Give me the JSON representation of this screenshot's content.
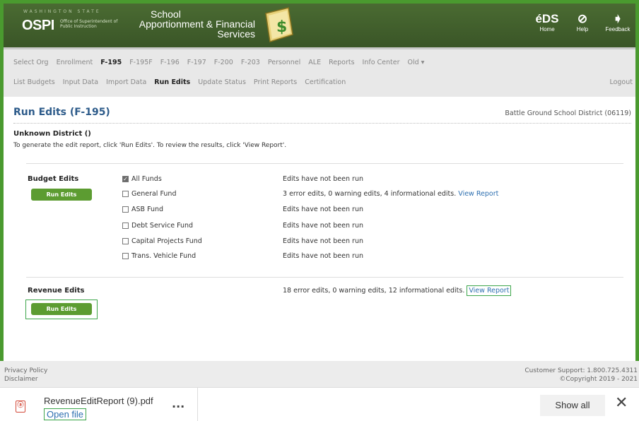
{
  "header": {
    "state_label": "WASHINGTON STATE",
    "ospi": "OSPI",
    "office_label": "Office of Superintendent of Public Instruction",
    "app_title_line1": "School",
    "app_title_line2": "Apportionment & Financial",
    "app_title_line3": "Services",
    "icons": [
      {
        "name": "eds",
        "glyph": "éDS",
        "label": "Home"
      },
      {
        "name": "help",
        "glyph": "⊘",
        "label": "Help"
      },
      {
        "name": "feedback",
        "glyph": "➧",
        "label": "Feedback"
      }
    ]
  },
  "nav": {
    "row1": [
      "Select Org",
      "Enrollment",
      "F-195",
      "F-195F",
      "F-196",
      "F-197",
      "F-200",
      "F-203",
      "Personnel",
      "ALE",
      "Reports",
      "Info Center",
      "Old ▾"
    ],
    "row1_active": "F-195",
    "row2": [
      "List Budgets",
      "Input Data",
      "Import Data",
      "Run Edits",
      "Update Status",
      "Print Reports",
      "Certification"
    ],
    "row2_active": "Run Edits",
    "logout": "Logout"
  },
  "page": {
    "title": "Run Edits (F-195)",
    "district": "Battle Ground School District (06119)",
    "unknown": "Unknown District ()",
    "instructions": "To generate the edit report, click 'Run Edits'. To review the results, click 'View Report'."
  },
  "budget": {
    "label": "Budget Edits",
    "button": "Run Edits",
    "funds": [
      {
        "name": "All Funds",
        "checked": true,
        "status": "Edits have not been run",
        "link": ""
      },
      {
        "name": "General Fund",
        "checked": false,
        "status": "3 error edits, 0 warning edits, 4 informational edits.",
        "link": "View Report"
      },
      {
        "name": "ASB Fund",
        "checked": false,
        "status": "Edits have not been run",
        "link": ""
      },
      {
        "name": "Debt Service Fund",
        "checked": false,
        "status": "Edits have not been run",
        "link": ""
      },
      {
        "name": "Capital Projects Fund",
        "checked": false,
        "status": "Edits have not been run",
        "link": ""
      },
      {
        "name": "Trans. Vehicle Fund",
        "checked": false,
        "status": "Edits have not been run",
        "link": ""
      }
    ]
  },
  "revenue": {
    "label": "Revenue Edits",
    "button": "Run Edits",
    "status": "18 error edits, 0 warning edits, 12 informational edits.",
    "link": "View Report"
  },
  "footer": {
    "privacy": "Privacy Policy",
    "disclaimer": "Disclaimer",
    "support": "Customer Support: 1.800.725.4311",
    "copyright": "©Copyright 2019 - 2021"
  },
  "downloads": {
    "filename": "RevenueEditReport (9).pdf",
    "open": "Open file",
    "more": "...",
    "show_all": "Show all",
    "close": "✕"
  }
}
